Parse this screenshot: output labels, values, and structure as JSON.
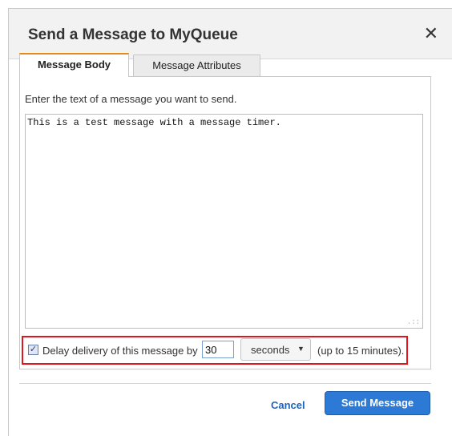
{
  "dialog": {
    "title": "Send a Message to MyQueue",
    "close_glyph": "✕"
  },
  "tabs": [
    {
      "label": "Message Body",
      "active": true
    },
    {
      "label": "Message Attributes",
      "active": false
    }
  ],
  "body": {
    "instruction": "Enter the text of a message you want to send.",
    "message_text": "This is a test message with a message timer.",
    "resize_glyph": ".::"
  },
  "delay": {
    "checked": true,
    "check_glyph": "✓",
    "label": "Delay delivery of this message by",
    "value": "30",
    "unit": "seconds",
    "unit_caret": "▼",
    "hint": "(up to 15 minutes)."
  },
  "footer": {
    "cancel_label": "Cancel",
    "send_label": "Send Message"
  },
  "colors": {
    "accent_tab": "#e48b18",
    "highlight_border": "#e0151e",
    "primary_button": "#2c7ad6",
    "link": "#1f63b7"
  }
}
